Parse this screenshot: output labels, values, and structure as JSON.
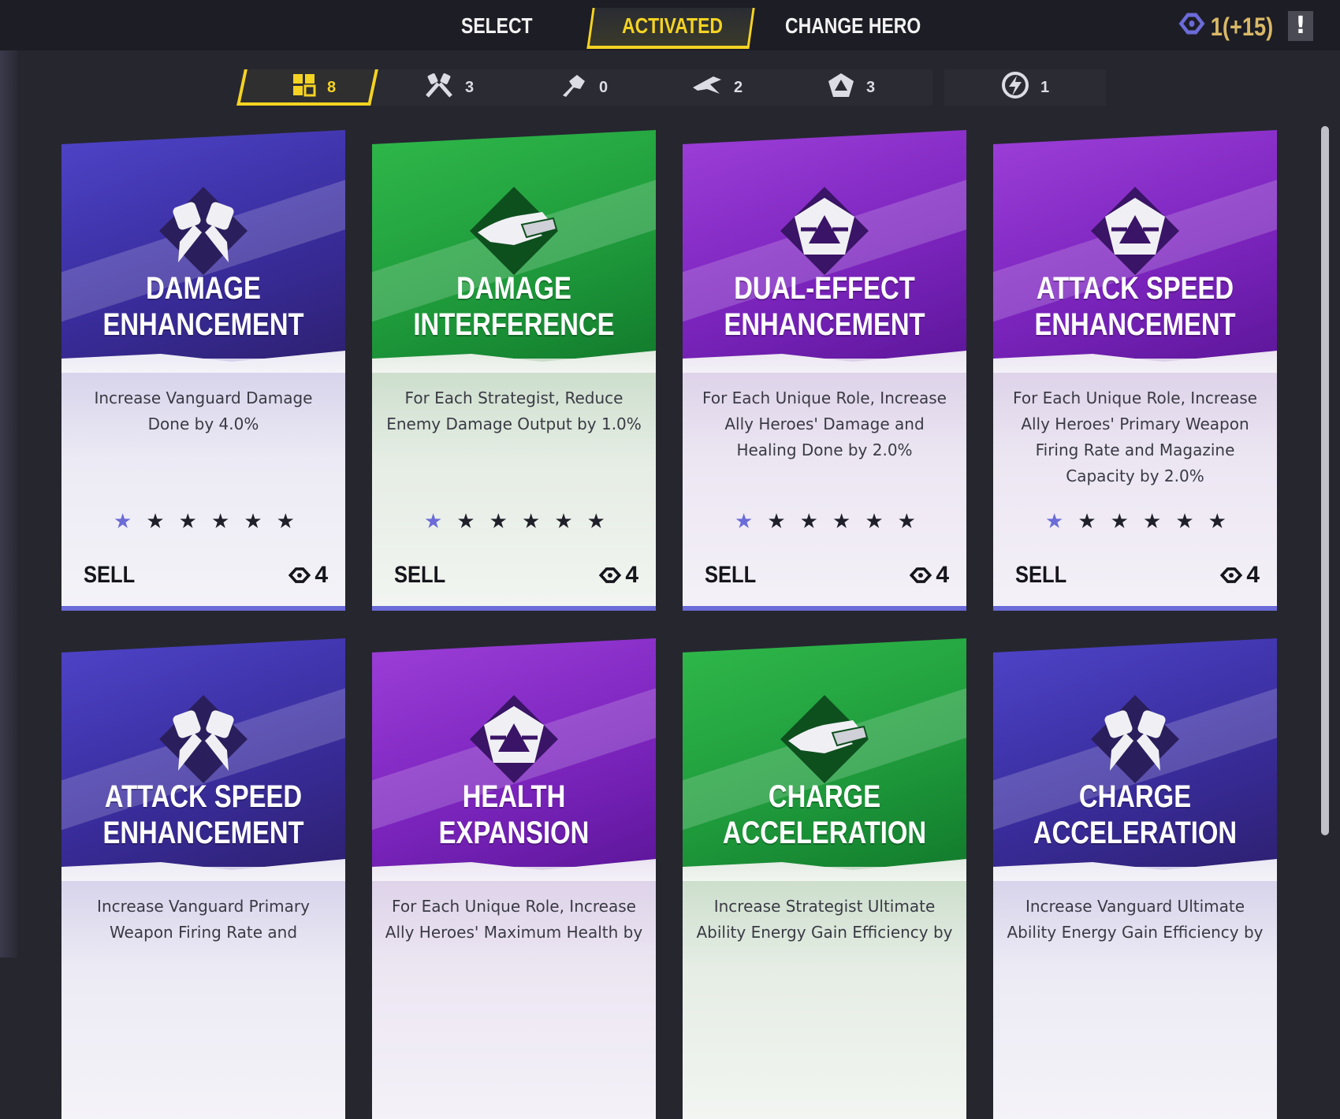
{
  "nav": {
    "tabs": [
      {
        "label": "SELECT"
      },
      {
        "label": "ACTIVATED",
        "active": true
      },
      {
        "label": "CHANGE HERO"
      }
    ]
  },
  "currency": {
    "value": "1(+15)",
    "icon": "chrono-token-icon"
  },
  "alert": {
    "label": "!"
  },
  "filters": [
    {
      "icon": "grid-icon",
      "count": "8",
      "active": true
    },
    {
      "icon": "vanguard-fists-icon",
      "count": "3"
    },
    {
      "icon": "duelist-icon",
      "count": "0"
    },
    {
      "icon": "wing-icon",
      "count": "2"
    },
    {
      "icon": "strategist-icon",
      "count": "3"
    },
    {
      "icon": "energy-bolt-icon",
      "count": "1"
    }
  ],
  "cards": [
    {
      "title_1": "DAMAGE",
      "title_2": "ENHANCEMENT",
      "description": "Increase Vanguard Damage Done by 4.0%",
      "rating": 1,
      "max_rating": 6,
      "sell_label": "SELL",
      "price": "4",
      "theme": "purple",
      "icon": "vanguard-fists-icon"
    },
    {
      "title_1": "DAMAGE",
      "title_2": "INTERFERENCE",
      "description": "For Each Strategist, Reduce Enemy Damage Output by 1.0%",
      "rating": 1,
      "max_rating": 6,
      "sell_label": "SELL",
      "price": "4",
      "theme": "green",
      "icon": "hand-card-icon"
    },
    {
      "title_1": "DUAL-EFFECT",
      "title_2": "ENHANCEMENT",
      "description": "For Each Unique Role, Increase Ally Heroes' Damage and Healing Done by 2.0%",
      "rating": 1,
      "max_rating": 6,
      "sell_label": "SELL",
      "price": "4",
      "theme": "violet",
      "icon": "strategist-icon"
    },
    {
      "title_1": "ATTACK SPEED",
      "title_2": "ENHANCEMENT",
      "description": "For Each Unique Role, Increase Ally Heroes' Primary Weapon Firing Rate and Magazine Capacity by 2.0%",
      "rating": 1,
      "max_rating": 6,
      "sell_label": "SELL",
      "price": "4",
      "theme": "violet",
      "icon": "strategist-icon"
    },
    {
      "title_1": "ATTACK SPEED",
      "title_2": "ENHANCEMENT",
      "description": "Increase Vanguard Primary Weapon Firing Rate and",
      "theme": "purple",
      "icon": "vanguard-fists-icon"
    },
    {
      "title_1": "HEALTH",
      "title_2": "EXPANSION",
      "description": "For Each Unique Role, Increase Ally Heroes' Maximum Health by",
      "theme": "violet",
      "icon": "strategist-icon"
    },
    {
      "title_1": "CHARGE",
      "title_2": "ACCELERATION",
      "description": "Increase Strategist Ultimate Ability Energy Gain Efficiency by",
      "theme": "green",
      "icon": "hand-card-icon"
    },
    {
      "title_1": "CHARGE",
      "title_2": "ACCELERATION",
      "description": "Increase Vanguard Ultimate Ability Energy Gain Efficiency by",
      "theme": "purple",
      "icon": "vanguard-fists-icon"
    }
  ],
  "colors": {
    "accent": "#f5d323",
    "background": "#26262f",
    "star_filled": "#6b6bd8",
    "purple": "#3a2d9e",
    "green": "#1f9c3c",
    "violet": "#7d25bf"
  }
}
